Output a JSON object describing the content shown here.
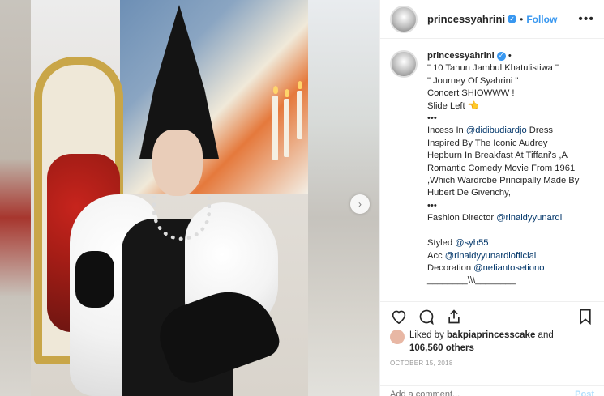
{
  "post": {
    "username": "princessyahrini",
    "follow_label": "Follow",
    "more_label": "•••",
    "next_label": "›"
  },
  "caption": {
    "username": "princessyahrini",
    "lines": [
      "\" 10 Tahun Jambul Khatulistiwa \"",
      "\" Journey Of Syahrini \"",
      "Concert SHIOWWW !",
      "Slide Left 👈",
      "•••",
      "Incess In ",
      "Inspired By The Iconic Audrey",
      "Hepburn In Breakfast At Tiffani's ,A",
      "Romantic Comedy Movie From 1961",
      ",Which Wardrobe Principally Made By",
      "Hubert De Givenchy,",
      "•••",
      "Fashion Director ",
      "",
      "Styled ",
      "Acc ",
      "Decoration ",
      "________\\\\\\________"
    ],
    "mention_dress": "@didibudiardjo",
    "dress_suffix": " Dress",
    "mention_fashion": "@rinaldyyunardi",
    "mention_styled": "@syh55",
    "mention_acc": "@rinaldyyunardiofficial",
    "mention_decoration": "@nefiantosetiono"
  },
  "likes": {
    "prefix": "Liked by ",
    "user": "bakpiaprincesscake",
    "middle": " and",
    "count": "106,560 others"
  },
  "date": "October 15, 2018",
  "comment": {
    "placeholder": "Add a comment...",
    "post_label": "Post"
  },
  "icons": {
    "verified": "✓"
  }
}
